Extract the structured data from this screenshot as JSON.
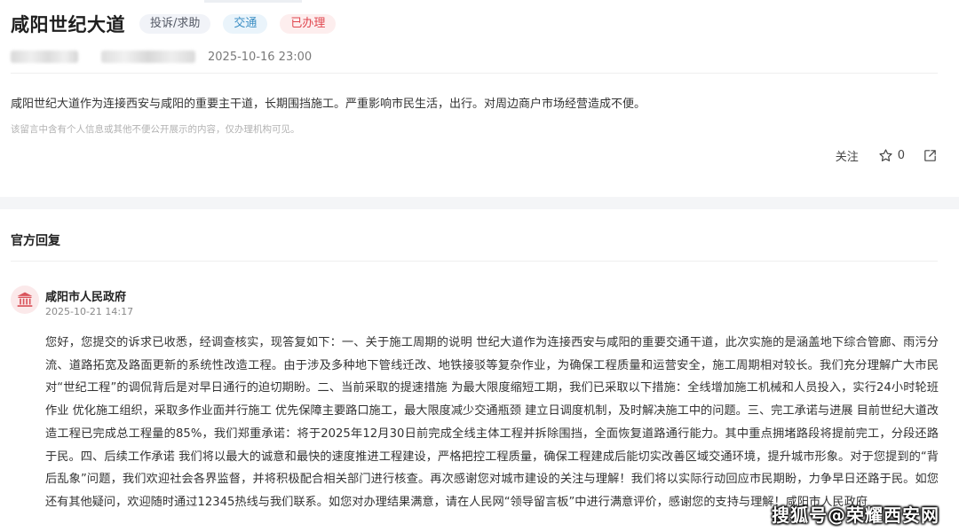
{
  "post": {
    "title": "咸阳世纪大道",
    "tags": [
      "投诉/求助",
      "交通",
      "已办理"
    ],
    "time": "2025-10-16 23:00",
    "content": "咸阳世纪大道作为连接西安与咸阳的重要主干道，长期围挡施工。严重影响市民生活，出行。对周边商户市场经营造成不便。",
    "notice": "该留言中含有个人信息或其他不便公开展示的内容，仅办理机构可见。",
    "actions": {
      "follow": "关注",
      "star_count": "0"
    }
  },
  "reply": {
    "section_title": "官方回复",
    "org": "咸阳市人民政府",
    "time": "2025-10-21 14:17",
    "body": "您好，您提交的诉求已收悉，经调查核实，现答复如下：一、关于施工周期的说明 世纪大道作为连接西安与咸阳的重要交通干道，此次实施的是涵盖地下综合管廊、雨污分流、道路拓宽及路面更新的系统性改造工程。由于涉及多种地下管线迁改、地铁接驳等复杂作业，为确保工程质量和运营安全，施工周期相对较长。我们充分理解广大市民对“世纪工程”的调侃背后是对早日通行的迫切期盼。二、当前采取的提速措施 为最大限度缩短工期，我们已采取以下措施：全线增加施工机械和人员投入，实行24小时轮班作业 优化施工组织，采取多作业面并行施工 优先保障主要路口施工，最大限度减少交通瓶颈 建立日调度机制，及时解决施工中的问题。三、完工承诺与进展 目前世纪大道改造工程已完成总工程量的85%，我们郑重承诺：将于2025年12月30日前完成全线主体工程并拆除围挡，全面恢复道路通行能力。其中重点拥堵路段将提前完工，分段还路于民。四、后续工作承诺 我们将以最大的诚意和最快的速度推进工程建设，严格把控工程质量，确保工程建成后能切实改善区域交通环境，提升城市形象。对于您提到的“背后乱象”问题，我们欢迎社会各界监督，并将积极配合相关部门进行核查。再次感谢您对城市建设的关注与理解！我们将以实际行动回应市民期盼，力争早日还路于民。如您还有其他疑问，欢迎随时通过12345热线与我们联系。如您对办理结果满意，请在人民网“领导留言板”中进行满意评价，感谢您的支持与理解！咸阳市人民政府"
  },
  "watermark": "搜狐号@荣耀西安网",
  "colors": {
    "tag_type_text": "#555a66",
    "tag_category_text": "#3d8fc4",
    "tag_status_text": "#e0464e",
    "gov_icon": "#d9535b"
  },
  "icons": [
    "star-icon",
    "share-icon",
    "government-building-icon"
  ]
}
